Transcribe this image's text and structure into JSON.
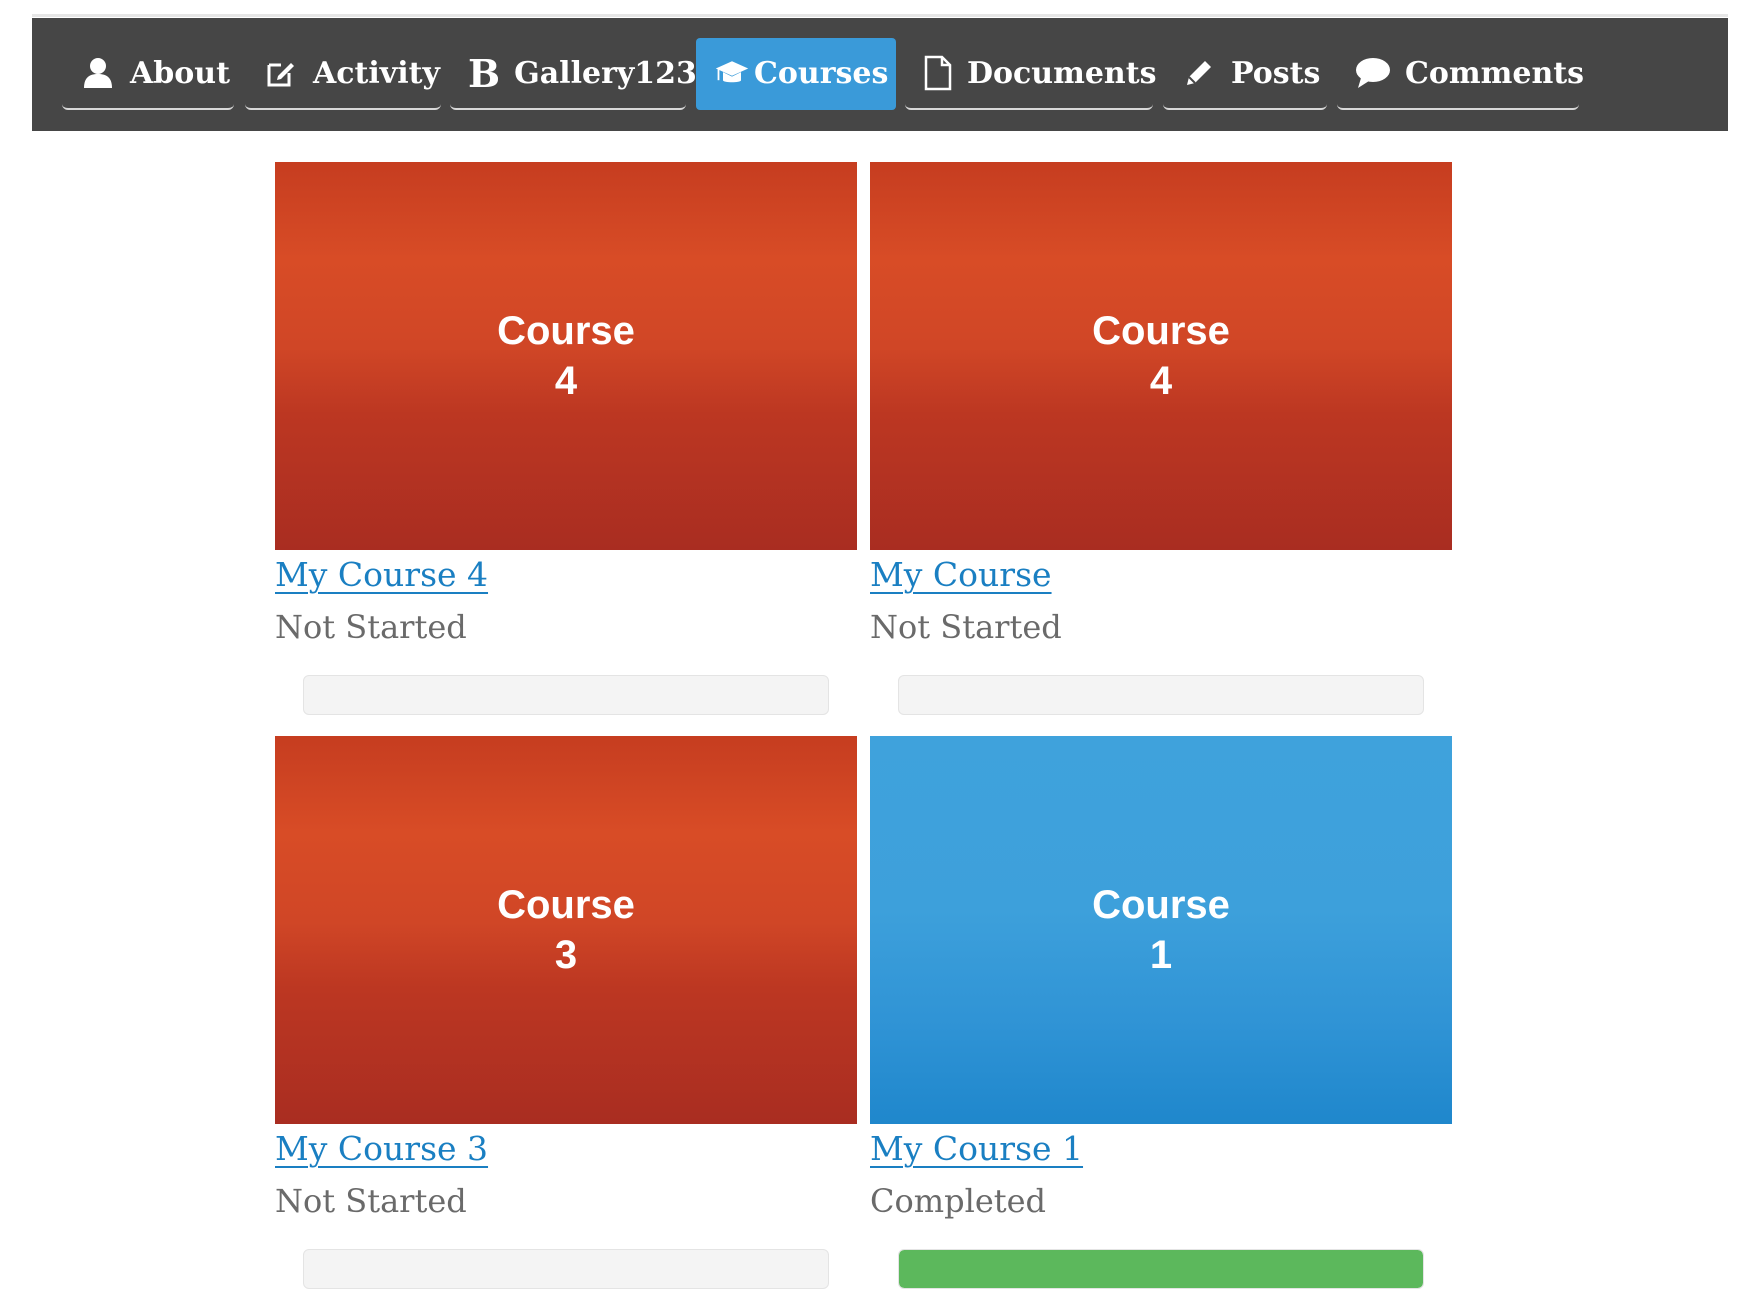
{
  "nav": {
    "tabs": [
      {
        "label": "About",
        "icon": "user-icon",
        "active": false
      },
      {
        "label": "Activity",
        "icon": "edit-icon",
        "active": false
      },
      {
        "label": "Gallery123",
        "icon": "bold-b-icon",
        "icon_glyph": "B",
        "active": false
      },
      {
        "label": "Courses",
        "icon": "graduation-cap-icon",
        "active": true
      },
      {
        "label": "Documents",
        "icon": "document-icon",
        "active": false
      },
      {
        "label": "Posts",
        "icon": "pencil-icon",
        "active": false
      },
      {
        "label": "Comments",
        "icon": "speech-bubble-icon",
        "active": false
      }
    ],
    "colors": {
      "bar": "#464646",
      "active": "#3a9ad9"
    }
  },
  "courses": [
    {
      "thumb_line1": "Course",
      "thumb_line2": "4",
      "thumb_color": "red",
      "title": "My Course 4",
      "status": "Not Started",
      "progress": 0
    },
    {
      "thumb_line1": "Course",
      "thumb_line2": "4",
      "thumb_color": "red",
      "title": "My Course",
      "status": "Not Started",
      "progress": 0
    },
    {
      "thumb_line1": "Course",
      "thumb_line2": "3",
      "thumb_color": "red",
      "title": "My Course 3",
      "status": "Not Started",
      "progress": 0
    },
    {
      "thumb_line1": "Course",
      "thumb_line2": "1",
      "thumb_color": "blue",
      "title": "My Course 1",
      "status": "Completed",
      "progress": 100
    }
  ],
  "colors": {
    "link": "#1a7fc2",
    "status_text": "#6a6a6a",
    "progress_fill": "#5cb85c",
    "thumb_red": "#d84c26",
    "thumb_blue": "#3da0db"
  }
}
